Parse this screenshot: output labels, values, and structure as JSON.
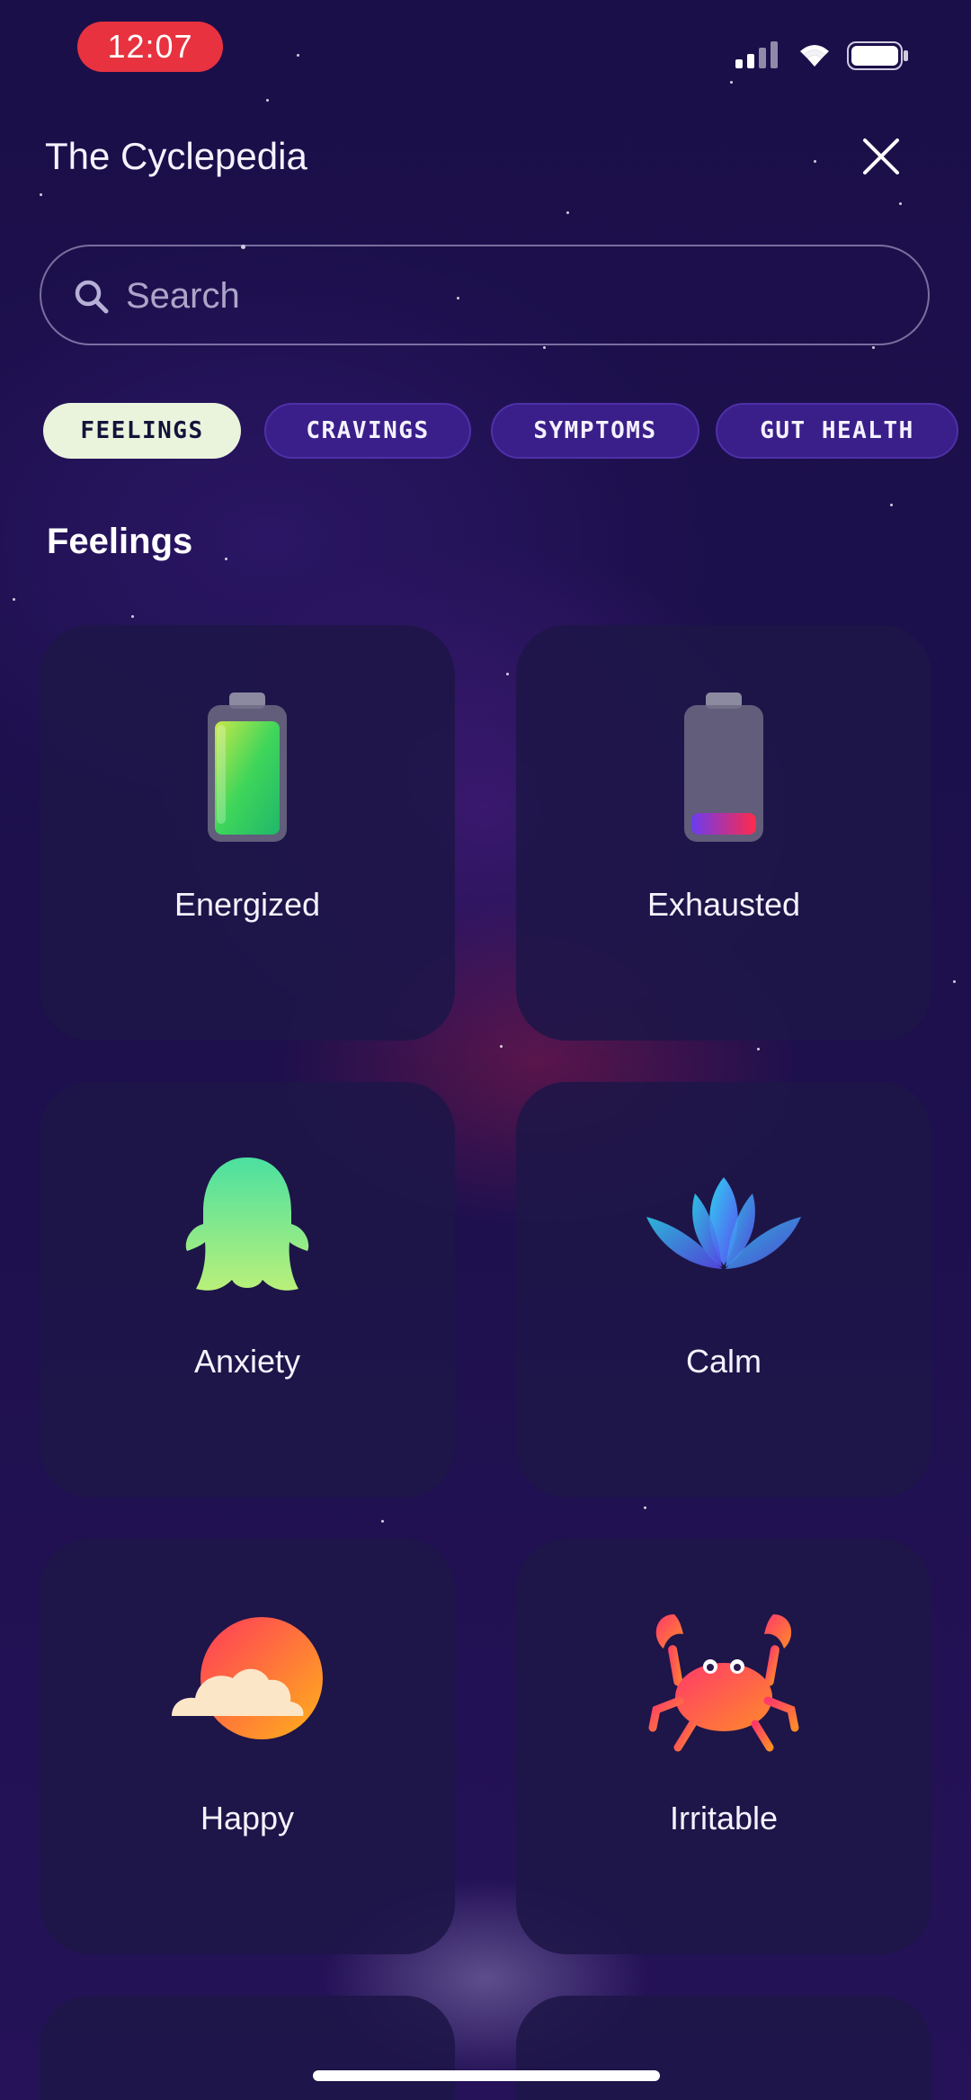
{
  "status_bar": {
    "time": "12:07"
  },
  "header": {
    "title": "The Cyclepedia"
  },
  "search": {
    "placeholder": "Search"
  },
  "chips": [
    {
      "label": "FEELINGS",
      "active": true
    },
    {
      "label": "CRAVINGS",
      "active": false
    },
    {
      "label": "SYMPTOMS",
      "active": false
    },
    {
      "label": "GUT HEALTH",
      "active": false
    }
  ],
  "section": {
    "title": "Feelings"
  },
  "cards": [
    {
      "label": "Energized",
      "icon": "battery-full-icon"
    },
    {
      "label": "Exhausted",
      "icon": "battery-low-icon"
    },
    {
      "label": "Anxiety",
      "icon": "ghost-icon"
    },
    {
      "label": "Calm",
      "icon": "lotus-icon"
    },
    {
      "label": "Happy",
      "icon": "sun-cloud-icon"
    },
    {
      "label": "Irritable",
      "icon": "crab-icon"
    }
  ],
  "colors": {
    "background": "#1a0f44",
    "card": "#1e1648",
    "chip_active": "#eaf4dd",
    "chip_idle": "#3a1f8a",
    "time_pill": "#e8323f"
  }
}
